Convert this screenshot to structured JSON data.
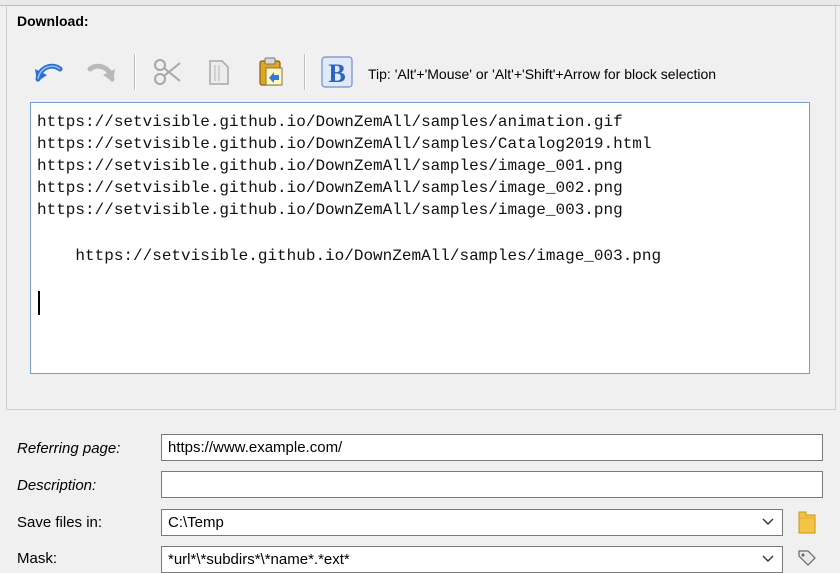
{
  "section": {
    "title": "Download:"
  },
  "toolbar": {
    "buttons": [
      {
        "icon": "undo-icon",
        "enabled": true
      },
      {
        "icon": "redo-icon",
        "enabled": false
      },
      {
        "icon": "cut-icon",
        "enabled": false
      },
      {
        "icon": "copy-icon",
        "enabled": false
      },
      {
        "icon": "paste-icon",
        "enabled": true
      },
      {
        "icon": "bold-b-icon",
        "enabled": true
      }
    ],
    "tip": "Tip: 'Alt'+'Mouse' or 'Alt'+'Shift'+Arrow for block selection"
  },
  "editor": {
    "lines": [
      "https://setvisible.github.io/DownZemAll/samples/animation.gif",
      "https://setvisible.github.io/DownZemAll/samples/Catalog2019.html",
      "https://setvisible.github.io/DownZemAll/samples/image_001.png",
      "https://setvisible.github.io/DownZemAll/samples/image_002.png",
      "https://setvisible.github.io/DownZemAll/samples/image_003.png",
      "",
      "    https://setvisible.github.io/DownZemAll/samples/image_003.png"
    ]
  },
  "form": {
    "referring_page": {
      "label": "Referring page:",
      "value": "https://www.example.com/"
    },
    "description": {
      "label": "Description:",
      "value": ""
    },
    "save_in": {
      "label": "Save files in:",
      "value": "C:\\Temp"
    },
    "mask": {
      "label": "Mask:",
      "value": "*url*\\*subdirs*\\*name*.*ext*"
    }
  },
  "colors": {
    "accent": "#3b7fd8",
    "editor_border": "#7a9ccc",
    "folder": "#f4c542"
  }
}
